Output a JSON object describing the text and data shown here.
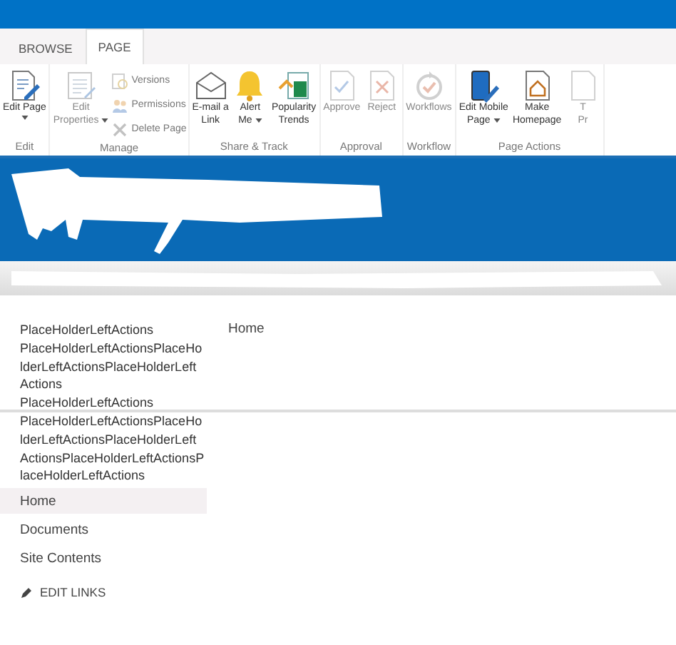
{
  "tabs": [
    {
      "label": "BROWSE",
      "selected": false
    },
    {
      "label": "PAGE",
      "selected": true
    }
  ],
  "ribbon": {
    "groups": [
      {
        "label": "Edit",
        "buttons": [
          {
            "kind": "large",
            "lines": [
              "Edit Page"
            ],
            "dropdown": true,
            "disabled": false
          }
        ]
      },
      {
        "label": "Manage",
        "buttons": [
          {
            "kind": "large",
            "lines": [
              "Edit",
              "Properties"
            ],
            "dropdown": true,
            "disabled": true
          },
          {
            "kind": "small",
            "lines": [
              "Versions"
            ],
            "disabled": true
          },
          {
            "kind": "small",
            "lines": [
              "Permissions"
            ],
            "disabled": true
          },
          {
            "kind": "small",
            "lines": [
              "Delete Page"
            ],
            "disabled": true
          }
        ]
      },
      {
        "label": "Share & Track",
        "buttons": [
          {
            "kind": "large",
            "lines": [
              "E-mail a",
              "Link"
            ],
            "disabled": false
          },
          {
            "kind": "large",
            "lines": [
              "Alert",
              "Me"
            ],
            "dropdown": true,
            "disabled": false
          },
          {
            "kind": "large",
            "lines": [
              "Popularity",
              "Trends"
            ],
            "disabled": false
          }
        ]
      },
      {
        "label": "Approval",
        "buttons": [
          {
            "kind": "large",
            "lines": [
              "Approve"
            ],
            "disabled": true
          },
          {
            "kind": "large",
            "lines": [
              "Reject"
            ],
            "disabled": true
          }
        ]
      },
      {
        "label": "Workflow",
        "buttons": [
          {
            "kind": "large",
            "lines": [
              "Workflows"
            ],
            "disabled": true
          }
        ]
      },
      {
        "label": "Page Actions",
        "buttons": [
          {
            "kind": "large",
            "lines": [
              "Edit Mobile",
              "Page"
            ],
            "dropdown": true,
            "disabled": false
          },
          {
            "kind": "large",
            "lines": [
              "Make",
              "Homepage"
            ],
            "disabled": false
          },
          {
            "kind": "large",
            "lines": [
              "T",
              "Pr"
            ],
            "disabled": true
          }
        ]
      }
    ]
  },
  "left_actions": [
    "PlaceHolderLeftActions",
    "PlaceHolderLeftActionsPlaceHolderLeftActionsPlaceHolderLeftActions",
    "PlaceHolderLeftActions",
    "PlaceHolderLeftActionsPlaceHolderLeftActionsPlaceHolderLeftActionsPlaceHolderLeftActionsPlaceHolderLeftActions"
  ],
  "nav": [
    {
      "label": "Home",
      "selected": true
    },
    {
      "label": "Documents",
      "selected": false
    },
    {
      "label": "Site Contents",
      "selected": false
    }
  ],
  "edit_links": "EDIT LINKS",
  "breadcrumb": "Home"
}
